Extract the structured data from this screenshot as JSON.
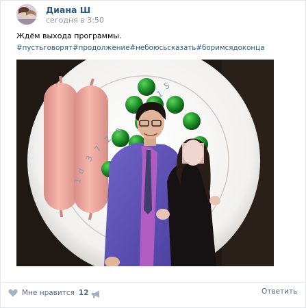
{
  "post": {
    "author": "Диана Ш",
    "time": "сегодня в 3:50",
    "text": "Ждём выхода программы.",
    "hashtags": "#пустьговорят#продолжение#небоюсьсказать#боримсядоконца",
    "plate_digits": [
      "1",
      "d",
      "3",
      "7",
      "2",
      "5",
      "4",
      "9",
      "1",
      "5"
    ]
  },
  "footer": {
    "like_label": "Мне нравится",
    "like_count": "12",
    "reply_label": "Ответить"
  },
  "icons": {
    "avatar": "avatar-image",
    "device": "apple-icon",
    "like": "heart-icon",
    "share": "megaphone-icon"
  },
  "colors": {
    "link": "#2a5885",
    "muted": "#939393",
    "action": "#55677d",
    "peas": "#1f8a2a",
    "sausage": "#f2a7a0"
  }
}
